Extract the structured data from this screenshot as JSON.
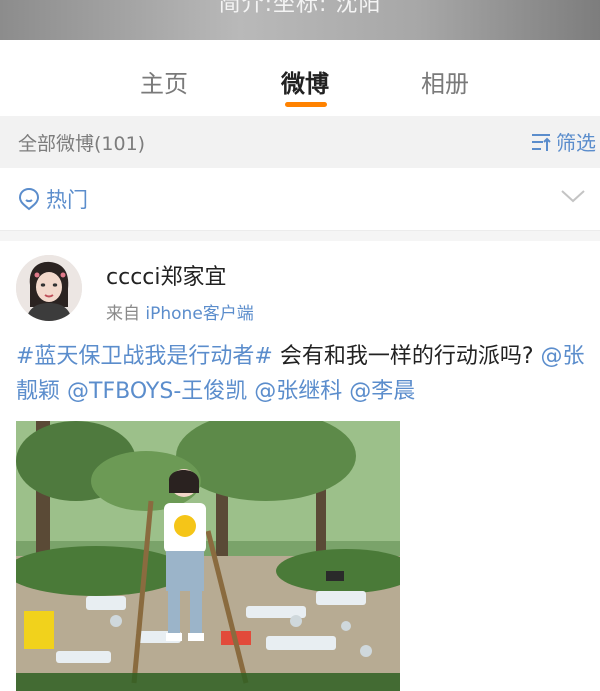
{
  "profile": {
    "intro_text": "简介:坐标: 沈阳"
  },
  "tabs": [
    {
      "label": "主页",
      "active": false
    },
    {
      "label": "微博",
      "active": true
    },
    {
      "label": "相册",
      "active": false
    }
  ],
  "filter_bar": {
    "all_posts_label": "全部微博(101)",
    "filter_label": "筛选"
  },
  "hot_filter": {
    "label": "热门"
  },
  "post": {
    "username": "cccci郑家宜",
    "source_prefix": "来自 ",
    "source_device": "iPhone客户端",
    "hashtag": "#蓝天保卫战我是行动者#",
    "text": " 会有和我一样的行动派吗? ",
    "mentions": [
      "@张靓颖",
      "@TFBOYS-王俊凯",
      "@张继科",
      "@李晨"
    ]
  },
  "colors": {
    "accent": "#ff8200",
    "link": "#5b8dcc"
  }
}
